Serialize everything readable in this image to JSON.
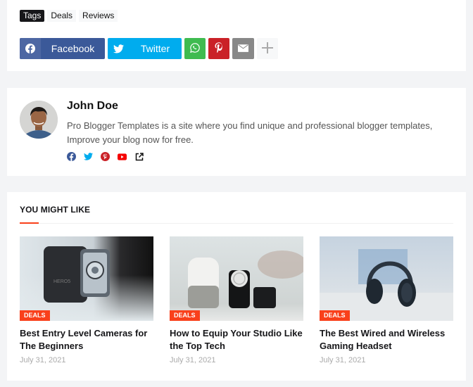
{
  "tags": {
    "label": "Tags",
    "items": [
      "Deals",
      "Reviews"
    ]
  },
  "share": {
    "facebook": {
      "label": "Facebook",
      "icon": "facebook-icon",
      "color": "#3b5999"
    },
    "twitter": {
      "label": "Twitter",
      "icon": "twitter-icon",
      "color": "#00acee"
    },
    "whatsapp": {
      "icon": "whatsapp-icon",
      "color": "#3fbb50"
    },
    "pinterest": {
      "icon": "pinterest-icon",
      "color": "#ca2127"
    },
    "email": {
      "icon": "email-icon",
      "color": "#888888"
    },
    "more": {
      "icon": "plus-icon"
    }
  },
  "author": {
    "name": "John Doe",
    "bio": "Pro Blogger Templates is a site where you find unique and professional blogger templates, Improve your blog now for free.",
    "links": [
      "facebook-icon",
      "twitter-icon",
      "pinterest-icon",
      "youtube-icon",
      "external-link-icon"
    ]
  },
  "related": {
    "title": "YOU MIGHT LIKE",
    "accent_color": "#f9401b",
    "posts": [
      {
        "badge": "DEALS",
        "title": "Best Entry Level Cameras for The Beginners",
        "date": "July 31, 2021",
        "image": "action-camera"
      },
      {
        "badge": "DEALS",
        "title": "How to Equip Your Studio Like the Top Tech",
        "date": "July 31, 2021",
        "image": "smart-home-devices"
      },
      {
        "badge": "DEALS",
        "title": "The Best Wired and Wireless Gaming Headset",
        "date": "July 31, 2021",
        "image": "headphones"
      }
    ]
  }
}
